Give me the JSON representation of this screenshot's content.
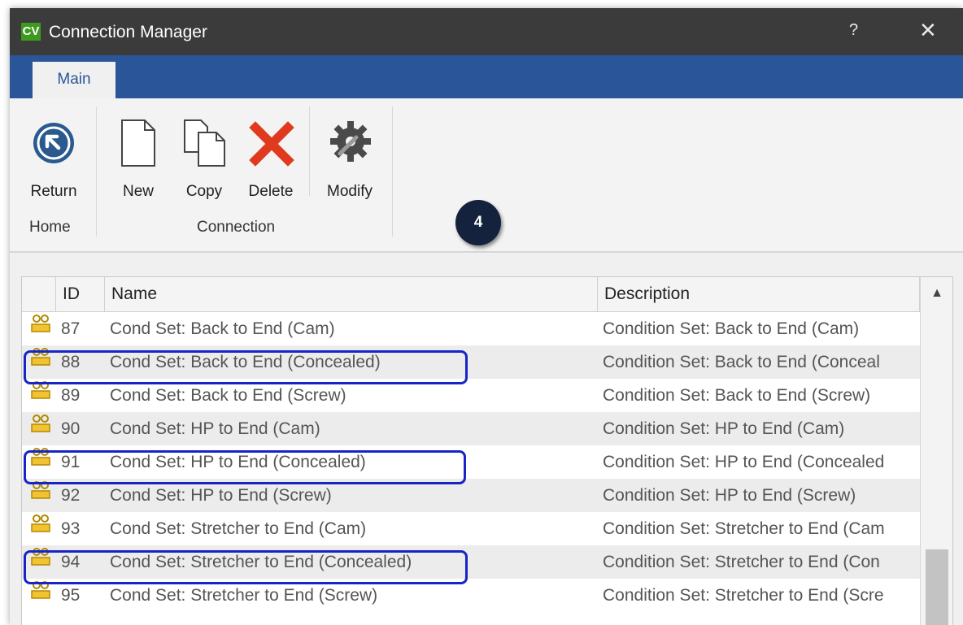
{
  "window": {
    "title": "Connection Manager",
    "logo": "CV",
    "help": "?",
    "close": "✕"
  },
  "ribbon": {
    "tab": "Main",
    "buttons": {
      "return": "Return",
      "new": "New",
      "copy": "Copy",
      "delete": "Delete",
      "modify": "Modify"
    },
    "groups": {
      "home": "Home",
      "connection": "Connection"
    }
  },
  "annotation": {
    "step": "4"
  },
  "table": {
    "columns": {
      "id": "ID",
      "name": "Name",
      "description": "Description"
    },
    "rows": [
      {
        "id": "87",
        "name": "Cond Set: Back to End (Cam)",
        "description": "Condition Set: Back to End (Cam)"
      },
      {
        "id": "88",
        "name": "Cond Set: Back to End (Concealed)",
        "description": "Condition Set: Back to End (Conceal"
      },
      {
        "id": "89",
        "name": "Cond Set: Back to End (Screw)",
        "description": "Condition Set: Back to End (Screw)"
      },
      {
        "id": "90",
        "name": "Cond Set: HP to End (Cam)",
        "description": "Condition Set: HP to End (Cam)"
      },
      {
        "id": "91",
        "name": "Cond Set: HP to End (Concealed)",
        "description": "Condition Set: HP to End (Concealed"
      },
      {
        "id": "92",
        "name": "Cond Set: HP to End (Screw)",
        "description": "Condition Set: HP to End (Screw)"
      },
      {
        "id": "93",
        "name": "Cond Set: Stretcher to End (Cam)",
        "description": "Condition Set: Stretcher to End (Cam"
      },
      {
        "id": "94",
        "name": "Cond Set: Stretcher to End (Concealed)",
        "description": "Condition Set: Stretcher to End (Con"
      },
      {
        "id": "95",
        "name": "Cond Set: Stretcher to End (Screw)",
        "description": "Condition Set: Stretcher to End (Scre"
      }
    ]
  },
  "colors": {
    "ribbon_blue": "#2a5699",
    "highlight": "#1724c7",
    "logo_green": "#3e9a1f"
  }
}
